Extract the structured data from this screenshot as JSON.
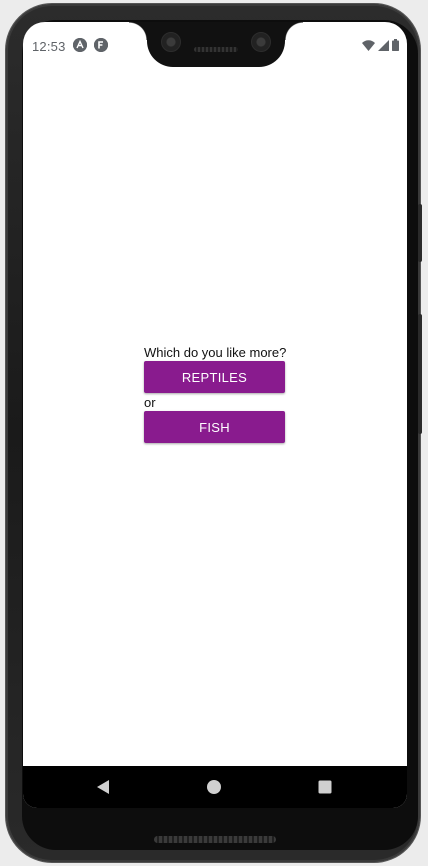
{
  "statusbar": {
    "time": "12:53",
    "left_icons": [
      "react-native-icon",
      "expo-icon"
    ],
    "right_icons": [
      "wifi-icon",
      "cell-signal-icon",
      "battery-icon"
    ]
  },
  "main": {
    "question": "Which do you like more?",
    "option1_label": "REPTILES",
    "separator": "or",
    "option2_label": "FISH"
  },
  "navbar": {
    "icons": [
      "back-icon",
      "home-icon",
      "recents-icon"
    ]
  },
  "colors": {
    "button_bg": "#891b8e",
    "button_text": "#ffffff",
    "screen_bg": "#ffffff",
    "status_text": "#5f6368"
  }
}
